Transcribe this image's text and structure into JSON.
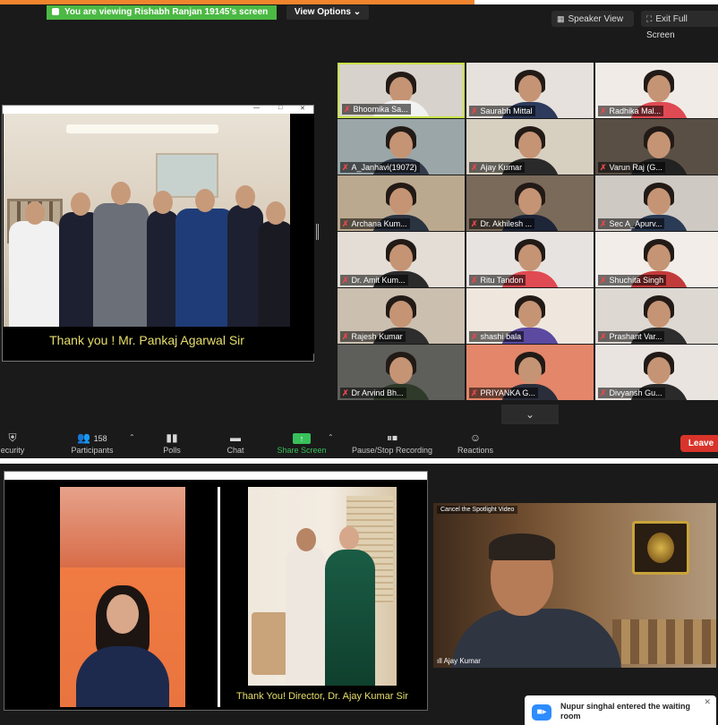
{
  "top_window": {
    "share_banner": "You are viewing Rishabh Ranjan 19145's screen",
    "view_options": "View Options",
    "speaker_view": "Speaker View",
    "exit_full_screen": "Exit Full Screen",
    "shared_caption": "Thank you ! Mr. Pankaj Agarwal Sir"
  },
  "gallery": {
    "tiles": [
      {
        "name": "Bhoomika Sa...",
        "active": true
      },
      {
        "name": "Saurabh Mittal"
      },
      {
        "name": "Radhika Mal..."
      },
      {
        "name": "A_Janhavi(19072)"
      },
      {
        "name": "Ajay Kumar"
      },
      {
        "name": "Varun Raj (G..."
      },
      {
        "name": "Archana Kum..."
      },
      {
        "name": "Dr. Akhilesh ..."
      },
      {
        "name": "Sec A_Apurv..."
      },
      {
        "name": "Dr. Amit Kum..."
      },
      {
        "name": "Ritu Tandon"
      },
      {
        "name": "Shuchita Singh"
      },
      {
        "name": "Rajesh Kumar"
      },
      {
        "name": "shashi bala"
      },
      {
        "name": "Prashant Var..."
      },
      {
        "name": "Dr Arvind Bh..."
      },
      {
        "name": "PRIYANKA G..."
      },
      {
        "name": "Divyansh Gu..."
      }
    ]
  },
  "toolbar": {
    "security": "ecurity",
    "participants": "Participants",
    "participants_count": "158",
    "polls": "Polls",
    "chat": "Chat",
    "share_screen": "Share Screen",
    "pause_stop_recording": "Pause/Stop Recording",
    "reactions": "Reactions",
    "leave": "Leave"
  },
  "bottom_window": {
    "shared_caption": "Thank You! Director, Dr. Ajay Kumar Sir",
    "spotlight_label": "Cancel the Spotlight Video",
    "speaker_name": "Ajay Kumar",
    "waiting_notice": "Nupur singhal entered the waiting room"
  },
  "colors": {
    "banner_green": "#4cb944",
    "leave_red": "#d9342b",
    "active_border": "#c7e34a",
    "mic_muted": "#e5484d",
    "zoom_blue": "#2d8cff"
  }
}
